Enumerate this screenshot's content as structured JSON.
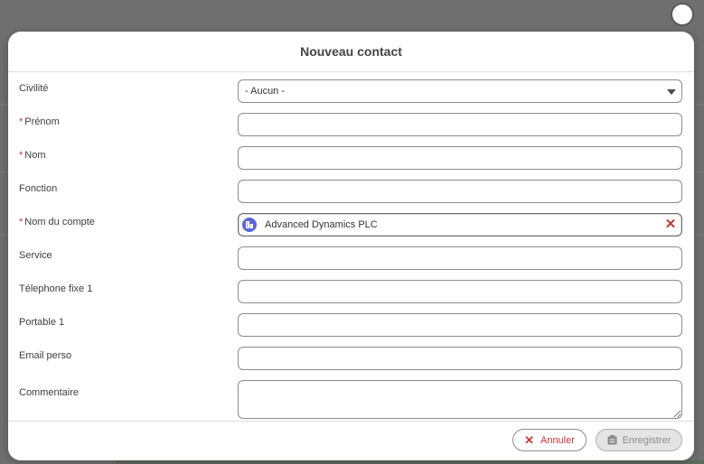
{
  "modal": {
    "title": "Nouveau contact"
  },
  "form": {
    "civilite": {
      "label": "Civilité",
      "value": "- Aucun -"
    },
    "prenom": {
      "label": "Prénom",
      "required_mark": "*",
      "value": ""
    },
    "nom": {
      "label": "Nom",
      "required_mark": "*",
      "value": ""
    },
    "fonction": {
      "label": "Fonction",
      "value": ""
    },
    "nom_du_compte": {
      "label": "Nom du compte",
      "required_mark": "*",
      "value": "Advanced Dynamics PLC",
      "icon": "account-icon",
      "clear_icon": "close-icon"
    },
    "service": {
      "label": "Service",
      "value": ""
    },
    "telephone_fixe": {
      "label": "Télephone fixe 1",
      "value": ""
    },
    "portable": {
      "label": "Portable 1",
      "value": ""
    },
    "email_perso": {
      "label": "Email perso",
      "value": ""
    },
    "commentaire": {
      "label": "Commentaire",
      "value": ""
    }
  },
  "footer": {
    "cancel_label": "Annuler",
    "save_label": "Enregistrer"
  },
  "colors": {
    "required": "#c23934",
    "account_icon_bg": "#5a67d8",
    "backdrop": "#6f6f6f"
  }
}
